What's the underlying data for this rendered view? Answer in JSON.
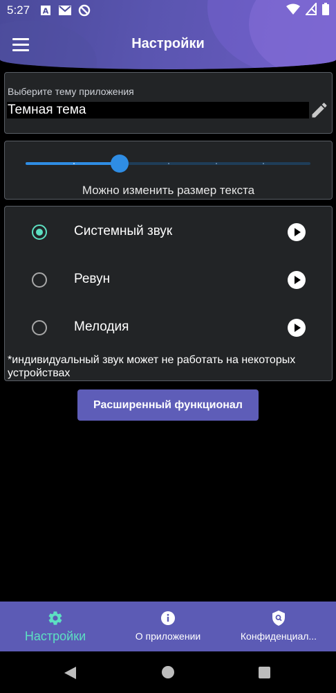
{
  "status_bar": {
    "time": "5:27",
    "icons": [
      "app-a-icon",
      "gmail-icon",
      "vpn-icon",
      "wifi-icon",
      "no-sim-icon",
      "battery-icon"
    ]
  },
  "header": {
    "title": "Настройки",
    "menu_icon": "hamburger-menu-icon"
  },
  "theme": {
    "label": "Выберите тему приложения",
    "value": "Темная тема",
    "edit_icon": "pencil-icon"
  },
  "text_size": {
    "caption": "Можно изменить размер текста",
    "level": 0.33,
    "steps": 7
  },
  "sounds": {
    "items": [
      {
        "label": "Системный звук",
        "selected": true
      },
      {
        "label": "Ревун",
        "selected": false
      },
      {
        "label": "Мелодия",
        "selected": false
      }
    ],
    "note": "*индивидуальный звук может не работать на некоторых устройствах"
  },
  "advanced_button": {
    "label": "Расширенный функционал"
  },
  "bottom_nav": {
    "items": [
      {
        "label": "Настройки",
        "icon": "gear-icon",
        "active": true
      },
      {
        "label": "О приложении",
        "icon": "info-icon",
        "active": false
      },
      {
        "label": "Конфиденциал...",
        "icon": "privacy-shield-icon",
        "active": false
      }
    ]
  },
  "colors": {
    "accent": "#5de0c2",
    "primary": "#5c5bb5",
    "slider": "#2f8de4",
    "background": "#000000",
    "card": "#222426"
  }
}
